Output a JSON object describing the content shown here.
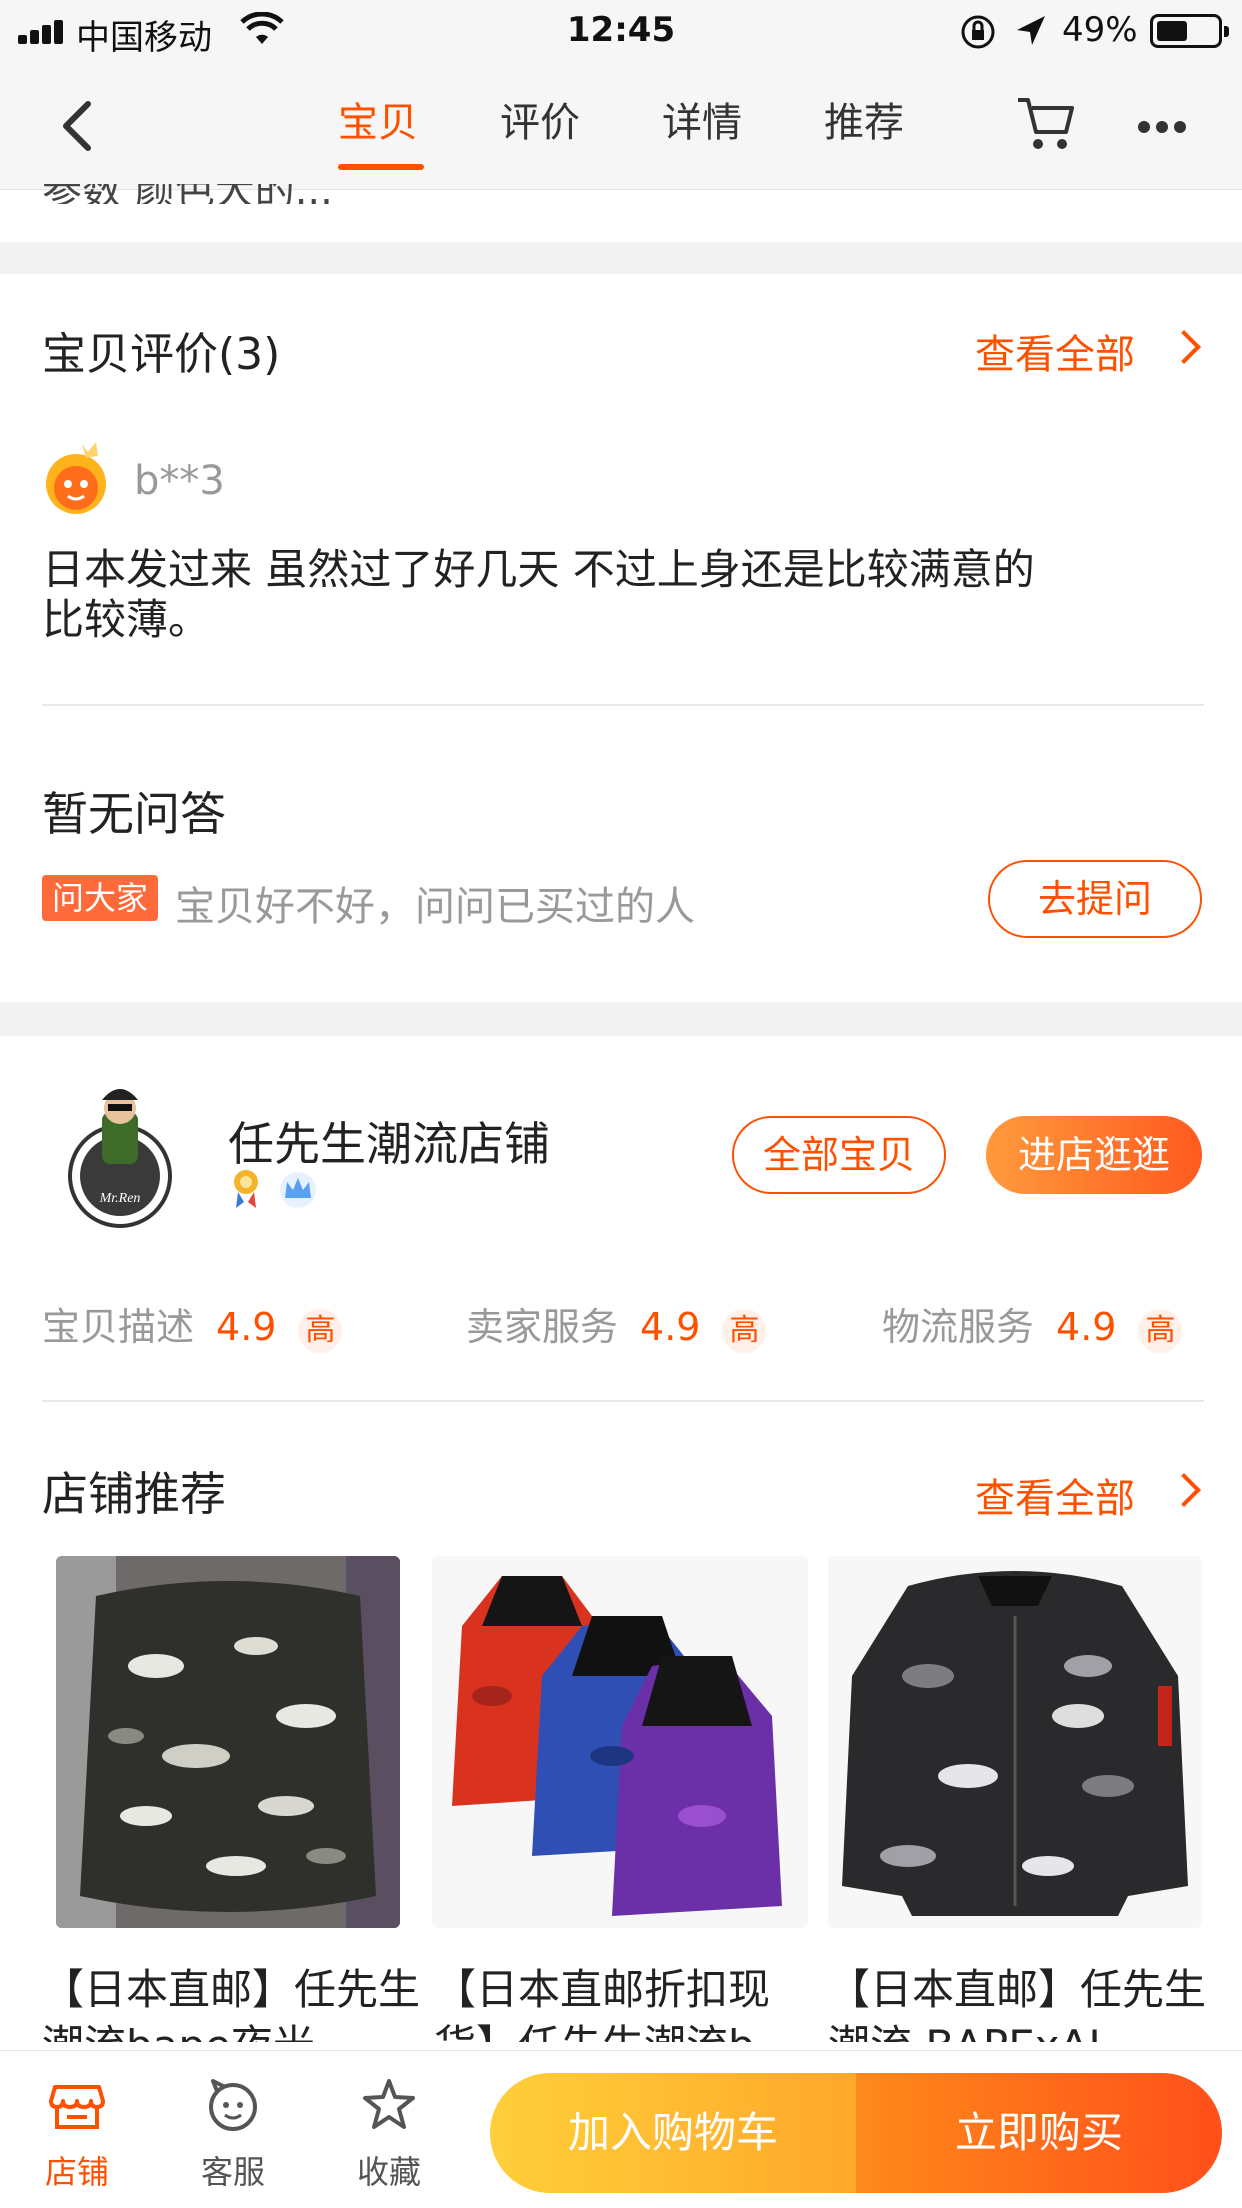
{
  "status_bar": {
    "carrier": "中国移动",
    "time": "12:45",
    "battery": "49%"
  },
  "nav": {
    "tabs": [
      {
        "label": "宝贝",
        "active": true
      },
      {
        "label": "评价",
        "active": false
      },
      {
        "label": "详情",
        "active": false
      },
      {
        "label": "推荐",
        "active": false
      }
    ],
    "icons": [
      "back-icon",
      "cart-icon",
      "more-icon"
    ]
  },
  "clipped_text": "参数 颜色大的...",
  "reviews": {
    "title": "宝贝评价(3)",
    "view_all": "查看全部",
    "items": [
      {
        "user": "b**3",
        "lines": [
          "日本发过来 虽然过了好几天 不过上身还是比较满意的",
          "比较薄。"
        ]
      }
    ]
  },
  "qa": {
    "title": "暂无问答",
    "badge": "问大家",
    "hint": "宝贝好不好，问问已买过的人",
    "ask_button": "去提问"
  },
  "shop": {
    "name": "任先生潮流店铺",
    "all_items_button": "全部宝贝",
    "enter_button": "进店逛逛",
    "ratings": [
      {
        "label": "宝贝描述",
        "value": "4.9",
        "level": "高"
      },
      {
        "label": "卖家服务",
        "value": "4.9",
        "level": "高"
      },
      {
        "label": "物流服务",
        "value": "4.9",
        "level": "高"
      }
    ]
  },
  "recommend": {
    "title": "店铺推荐",
    "view_all": "查看全部",
    "products": [
      {
        "title": "【日本直邮】任先生潮流bape夜光"
      },
      {
        "title": "【日本直邮折扣现货】任先生潮流b"
      },
      {
        "title": "【日本直邮】任先生潮流 BAPExAL"
      }
    ]
  },
  "bottom_bar": {
    "items": [
      {
        "label": "店铺",
        "icon": "shop-icon"
      },
      {
        "label": "客服",
        "icon": "service-icon"
      },
      {
        "label": "收藏",
        "icon": "star-icon"
      }
    ],
    "add_to_cart": "加入购物车",
    "buy_now": "立即购买"
  },
  "colors": {
    "accent": "#ff5000",
    "cta_yellow": "#ffc93a",
    "cta_orange": "#ff5a1f"
  }
}
